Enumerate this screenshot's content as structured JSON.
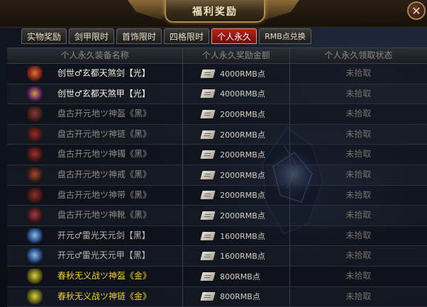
{
  "header": {
    "title": "福利奖励",
    "close_label": "✕"
  },
  "tabs": [
    {
      "label": "实物奖励",
      "active": false
    },
    {
      "label": "剑甲限时",
      "active": false
    },
    {
      "label": "首饰限时",
      "active": false
    },
    {
      "label": "四格限时",
      "active": false
    },
    {
      "label": "个人永久",
      "active": true
    },
    {
      "label": "RMB点兑换",
      "active": false
    }
  ],
  "table": {
    "headers": [
      "个人永久装备名称",
      "个人永久奖励金额",
      "个人永久领取状态"
    ],
    "rows": [
      {
        "name": "创世♂玄都天煞剑【光】",
        "amount": "4000RMB点",
        "status": "未拾取",
        "name_color": "#f4f0e6",
        "icon": "sword-icon"
      },
      {
        "name": "创世♂玄都天煞甲【光】",
        "amount": "4000RMB点",
        "status": "未拾取",
        "name_color": "#f4f0e6",
        "icon": "armor-icon"
      },
      {
        "name": "盘古开元地ツ神盔《黑》",
        "amount": "2000RMB点",
        "status": "未拾取",
        "name_color": "#8e8c86",
        "icon": "helmet-icon"
      },
      {
        "name": "盘古开元地ツ神链《黑》",
        "amount": "2000RMB点",
        "status": "未拾取",
        "name_color": "#8e8c86",
        "icon": "necklace-icon"
      },
      {
        "name": "盘古开元地ツ神镯《黑》",
        "amount": "2000RMB点",
        "status": "未拾取",
        "name_color": "#8e8c86",
        "icon": "bracelet-icon"
      },
      {
        "name": "盘古开元地ツ神戒《黑》",
        "amount": "2000RMB点",
        "status": "未拾取",
        "name_color": "#8e8c86",
        "icon": "ring-icon"
      },
      {
        "name": "盘古开元地ツ神带《黑》",
        "amount": "2000RMB点",
        "status": "未拾取",
        "name_color": "#8e8c86",
        "icon": "belt-icon"
      },
      {
        "name": "盘古开元地ツ神靴《黑》",
        "amount": "2000RMB点",
        "status": "未拾取",
        "name_color": "#8e8c86",
        "icon": "boots-icon"
      },
      {
        "name": "开元♂雷光天元剑【黑】",
        "amount": "1600RMB点",
        "status": "未拾取",
        "name_color": "#b8b6b0",
        "icon": "sword-icon"
      },
      {
        "name": "开元♂雷光天元甲【黑】",
        "amount": "1600RMB点",
        "status": "未拾取",
        "name_color": "#b8b6b0",
        "icon": "armor-icon"
      },
      {
        "name": "春秋无义战ツ神盔《金》",
        "amount": "800RMB点",
        "status": "未拾取",
        "name_color": "#f2d21c",
        "icon": "helmet-icon"
      },
      {
        "name": "春秋无义战ツ神链《金》",
        "amount": "800RMB点",
        "status": "未拾取",
        "name_color": "#f2d21c",
        "icon": "necklace-icon"
      }
    ]
  },
  "colors": {
    "active_tab": "#b8241c",
    "gold_text": "#f2d21c",
    "white_text": "#f4f0e6",
    "gray_text": "#8e8c86"
  }
}
